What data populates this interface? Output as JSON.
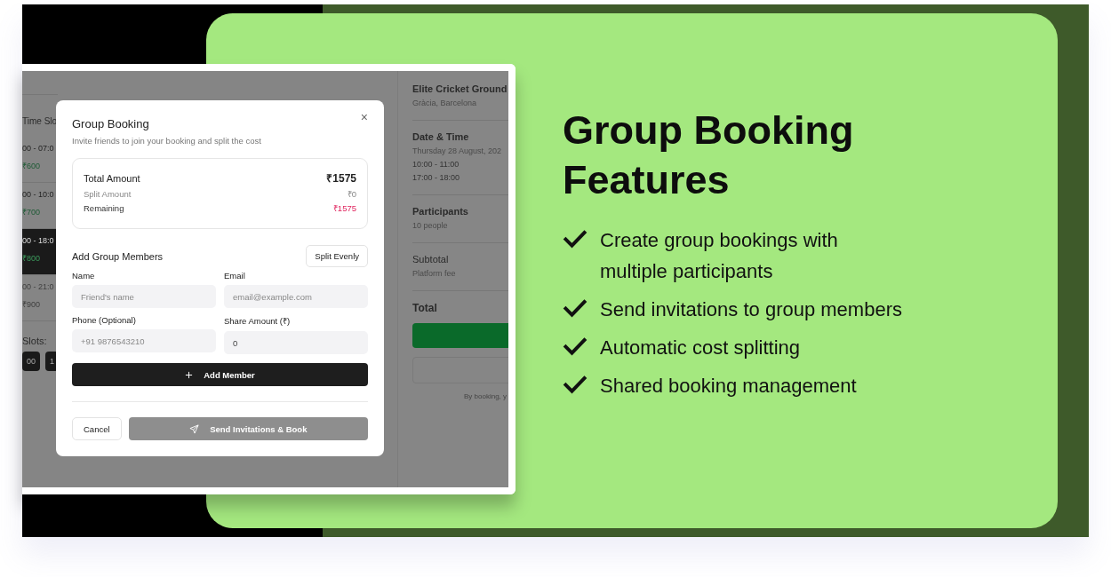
{
  "app_screenshot": {
    "slots_panel": {
      "heading": "Time Slo",
      "slots": [
        {
          "time": "00 - 07:0",
          "price": "₹600",
          "selected": false,
          "disabled": false
        },
        {
          "time": "00 - 10:0",
          "price": "₹700",
          "selected": false,
          "disabled": false
        },
        {
          "time": "00 - 18:0",
          "price": "₹800",
          "selected": true,
          "disabled": false
        },
        {
          "time": "00 - 21:0",
          "price": "₹900",
          "selected": false,
          "disabled": true
        }
      ],
      "selected_label": "Slots:",
      "chips": [
        "00",
        "1"
      ]
    },
    "summary": {
      "venue_name": "Elite Cricket Ground",
      "venue_location": "Gràcia, Barcelona",
      "date_heading": "Date & Time",
      "date": "Thursday 28 August, 202",
      "times": [
        "10:00 - 11:00",
        "17:00 - 18:00"
      ],
      "participants_heading": "Participants",
      "participants": "10 people",
      "subtotal_label": "Subtotal",
      "fee_label": "Platform fee",
      "total_label": "Total",
      "terms_note": "By booking, y"
    },
    "modal": {
      "title": "Group Booking",
      "close": "×",
      "subtitle": "Invite friends to join your booking and split the cost",
      "amounts": [
        {
          "label": "Total Amount",
          "value": "₹1575",
          "kind": "total"
        },
        {
          "label": "Split Amount",
          "value": "₹0",
          "kind": "split"
        },
        {
          "label": "Remaining",
          "value": "₹1575",
          "kind": "remaining"
        }
      ],
      "members_heading": "Add Group Members",
      "split_button": "Split Evenly",
      "fields": [
        {
          "label": "Name",
          "placeholder": "Friend's name"
        },
        {
          "label": "Email",
          "placeholder": "email@example.com"
        },
        {
          "label": "Phone (Optional)",
          "placeholder": "+91 9876543210"
        },
        {
          "label": "Share Amount (₹)",
          "value": "0"
        }
      ],
      "add_button": "Add Member",
      "cancel_button": "Cancel",
      "send_button": {
        "label": "Send Invitations & Book",
        "disabled": true
      }
    }
  },
  "feature_panel": {
    "title": "Group Booking Features",
    "features": [
      "Create group bookings with multiple participants",
      "Send invitations to group members",
      "Automatic cost splitting",
      "Shared booking management"
    ]
  }
}
